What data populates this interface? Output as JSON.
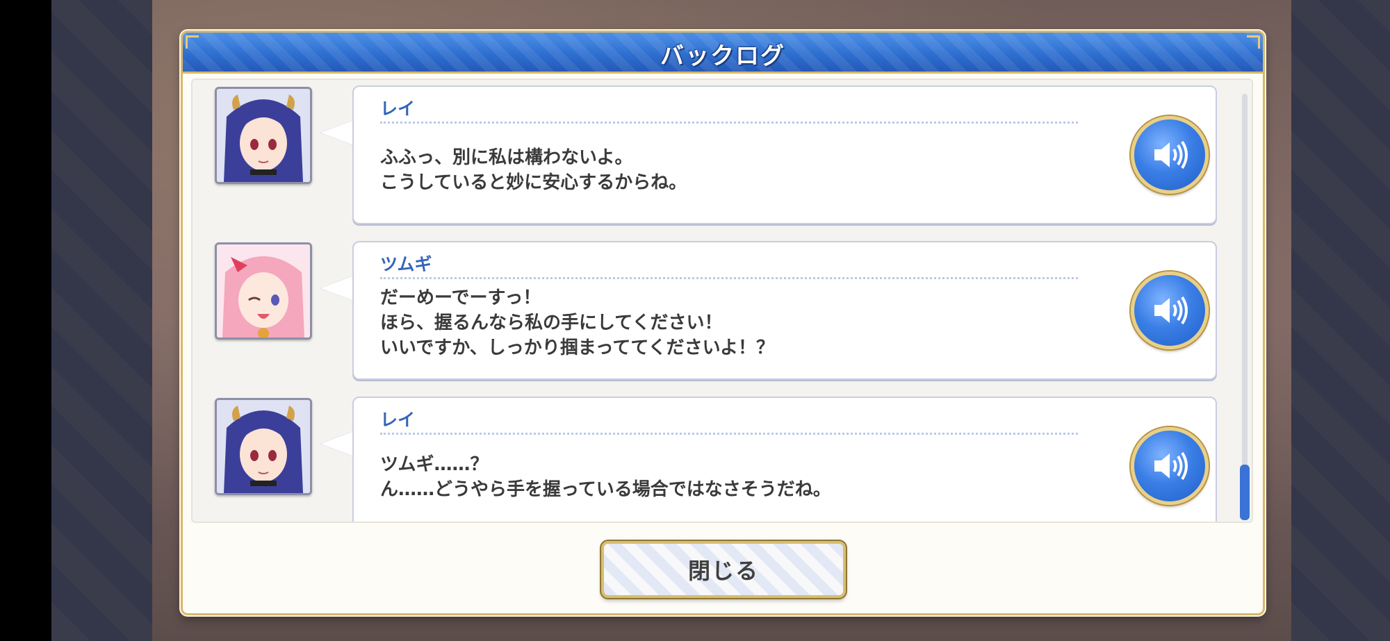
{
  "dialog": {
    "title": "バックログ",
    "close_label": "閉じる"
  },
  "entries": [
    {
      "speaker": "レイ",
      "lines": [
        "ふふっ、別に私は構わないよ。",
        "こうしていると妙に安心するからね。"
      ],
      "avatar": "rei-portrait",
      "voice_icon": "speaker-icon"
    },
    {
      "speaker": "ツムギ",
      "lines": [
        "だーめーでーすっ！",
        "ほら、握るんなら私の手にしてください！",
        "いいですか、しっかり掴まっててくださいよ！？"
      ],
      "avatar": "tsumugi-portrait",
      "voice_icon": "speaker-icon"
    },
    {
      "speaker": "レイ",
      "lines": [
        "ツムギ……？",
        "ん……どうやら手を握っている場合ではなさそうだね。"
      ],
      "avatar": "rei-portrait",
      "voice_icon": "speaker-icon"
    }
  ],
  "colors": {
    "title_bar": "#2e6fd0",
    "gold_border": "#d7b86b",
    "speaker_name": "#3464b8",
    "scroll_thumb": "#3a72d8"
  }
}
